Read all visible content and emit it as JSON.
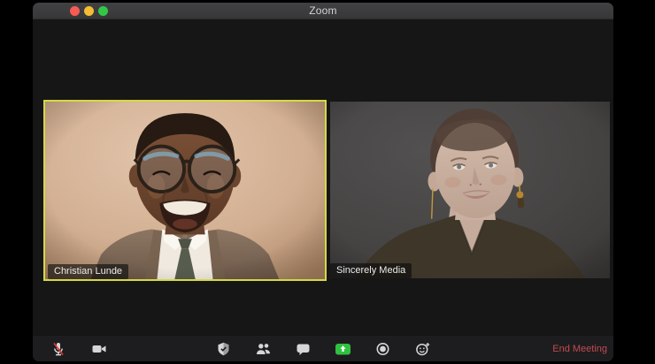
{
  "window": {
    "title": "Zoom",
    "traffic_lights": [
      {
        "name": "close",
        "color": "#f85b52"
      },
      {
        "name": "minimize",
        "color": "#f5bc34"
      },
      {
        "name": "zoom",
        "color": "#33c748"
      }
    ]
  },
  "participants": [
    {
      "name": "Christian Lunde",
      "active_speaker": true
    },
    {
      "name": "Sincerely Media",
      "active_speaker": false
    }
  ],
  "toolbar": {
    "left_icons": [
      "microphone-muted-icon",
      "video-camera-icon"
    ],
    "center_icons": [
      "security-shield-icon",
      "participants-icon",
      "chat-icon",
      "share-screen-icon",
      "record-icon",
      "reactions-icon"
    ],
    "end_meeting_label": "End Meeting"
  },
  "colors": {
    "active_speaker_border": "#d4d944",
    "share_screen_green": "#30c13f",
    "end_meeting_red": "#c24a50",
    "muted_slash_red": "#e23b3b",
    "titlebar_bg": "#3a3a3c",
    "stage_bg": "#161616",
    "toolbar_bg": "#1d1d1f"
  }
}
